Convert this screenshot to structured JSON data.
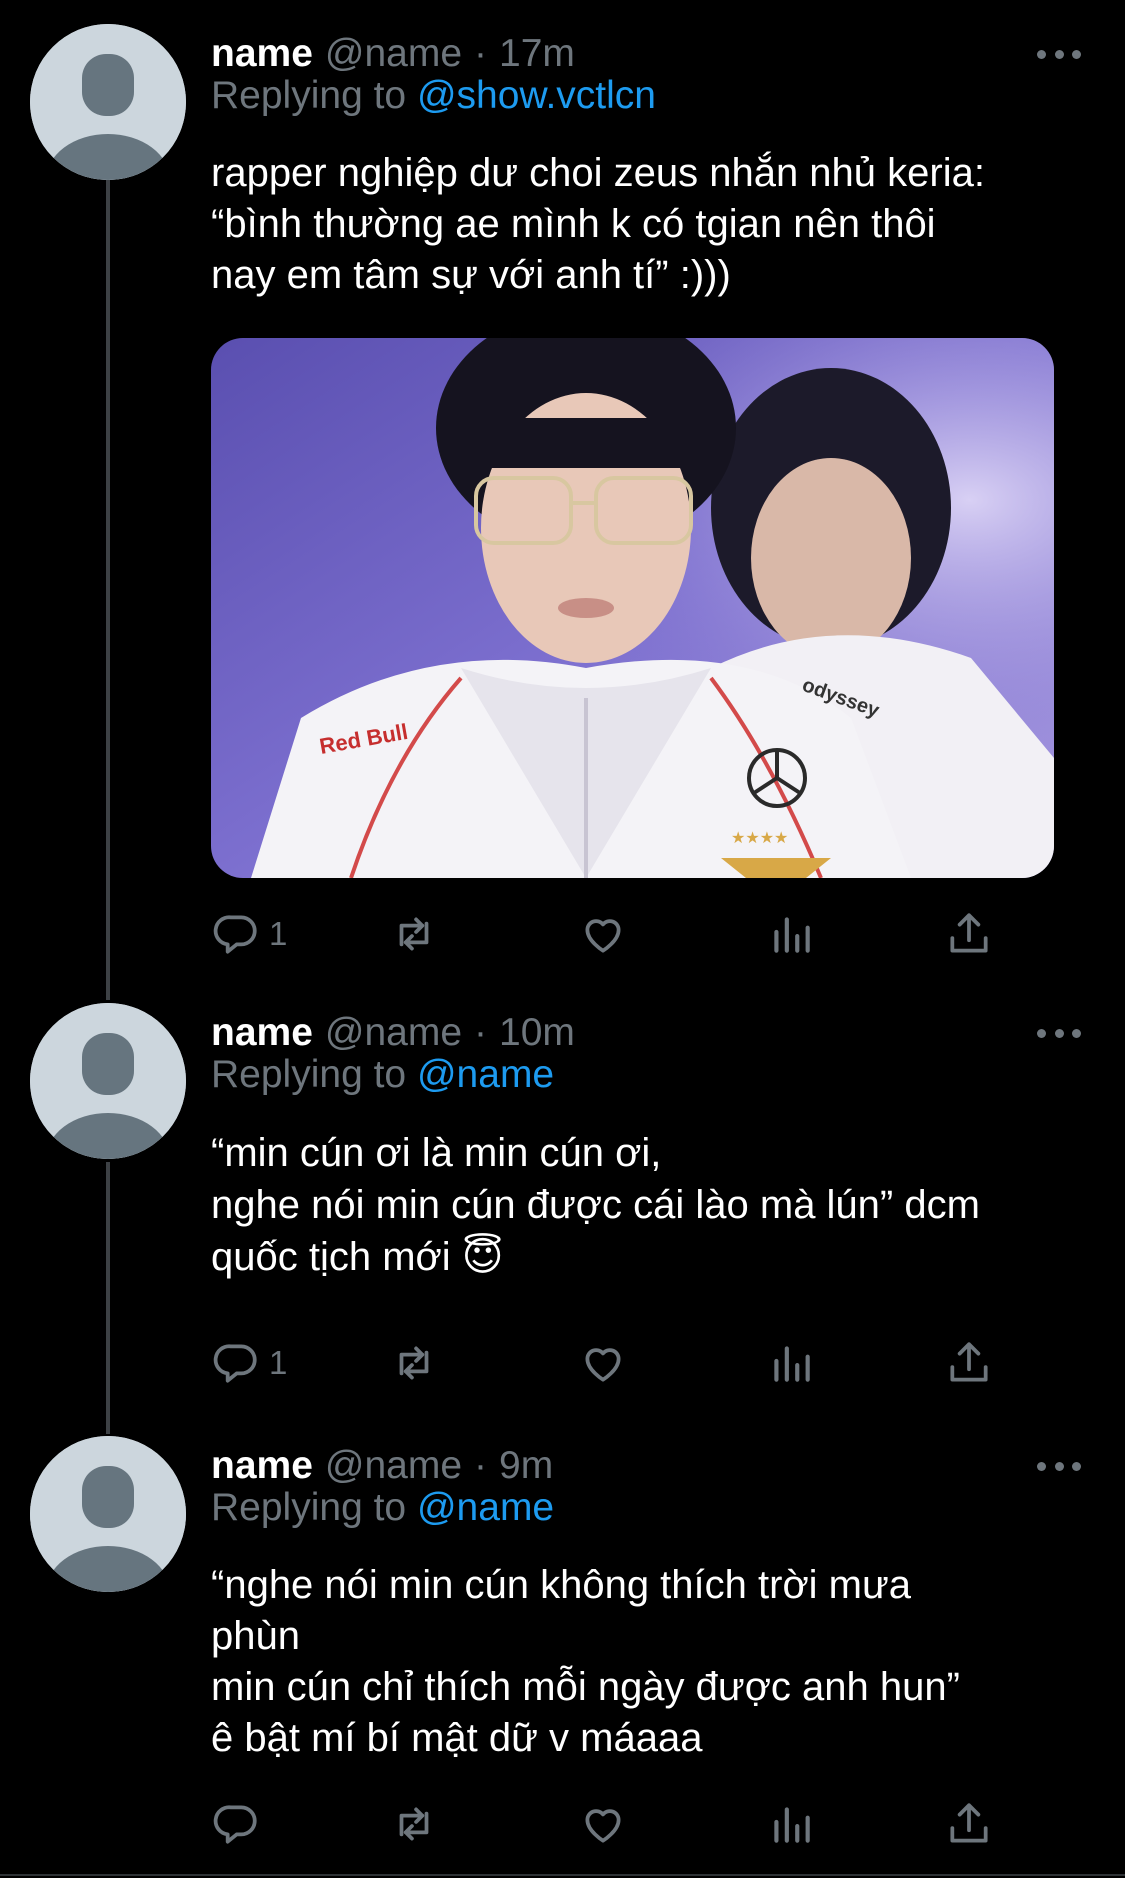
{
  "tweets": [
    {
      "name": "name",
      "handle": "@name",
      "separator": "·",
      "time": "17m",
      "replying_prefix": "Replying to",
      "replying_to": "@show.vctlcn",
      "text": "rapper nghiệp dư choi zeus nhắn nhủ keria:\n“bình thường ae mình k có tgian nên thôi\nnay em tâm sự với anh tí” :)))",
      "image_logo_left": "Red Bull",
      "image_logo_right": "odyssey",
      "reply_count": "1"
    },
    {
      "name": "name",
      "handle": "@name",
      "separator": "·",
      "time": "10m",
      "replying_prefix": "Replying to",
      "replying_to": "@name",
      "text": "“min cún ơi là min cún ơi,\nnghe nói min cún được cái lào mà lún” dcm\nquốc tịch mới 😇",
      "reply_count": "1"
    },
    {
      "name": "name",
      "handle": "@name",
      "separator": "·",
      "time": "9m",
      "replying_prefix": "Replying to",
      "replying_to": "@name",
      "text": "“nghe nói min cún không thích trời mưa\nphùn\nmin cún chỉ thích mỗi ngày được anh hun”\nê bật mí bí mật dữ v máaaa",
      "reply_count": ""
    }
  ],
  "colors": {
    "background": "#000000",
    "secondary_text": "#6e767d",
    "link": "#1d9bf0",
    "avatar_bg": "#ccd6dd",
    "avatar_fg": "#66757f",
    "thread_line": "#3d4145"
  },
  "icons": [
    "reply-icon",
    "retweet-icon",
    "like-icon",
    "analytics-icon",
    "share-icon",
    "more-icon",
    "default-avatar"
  ]
}
